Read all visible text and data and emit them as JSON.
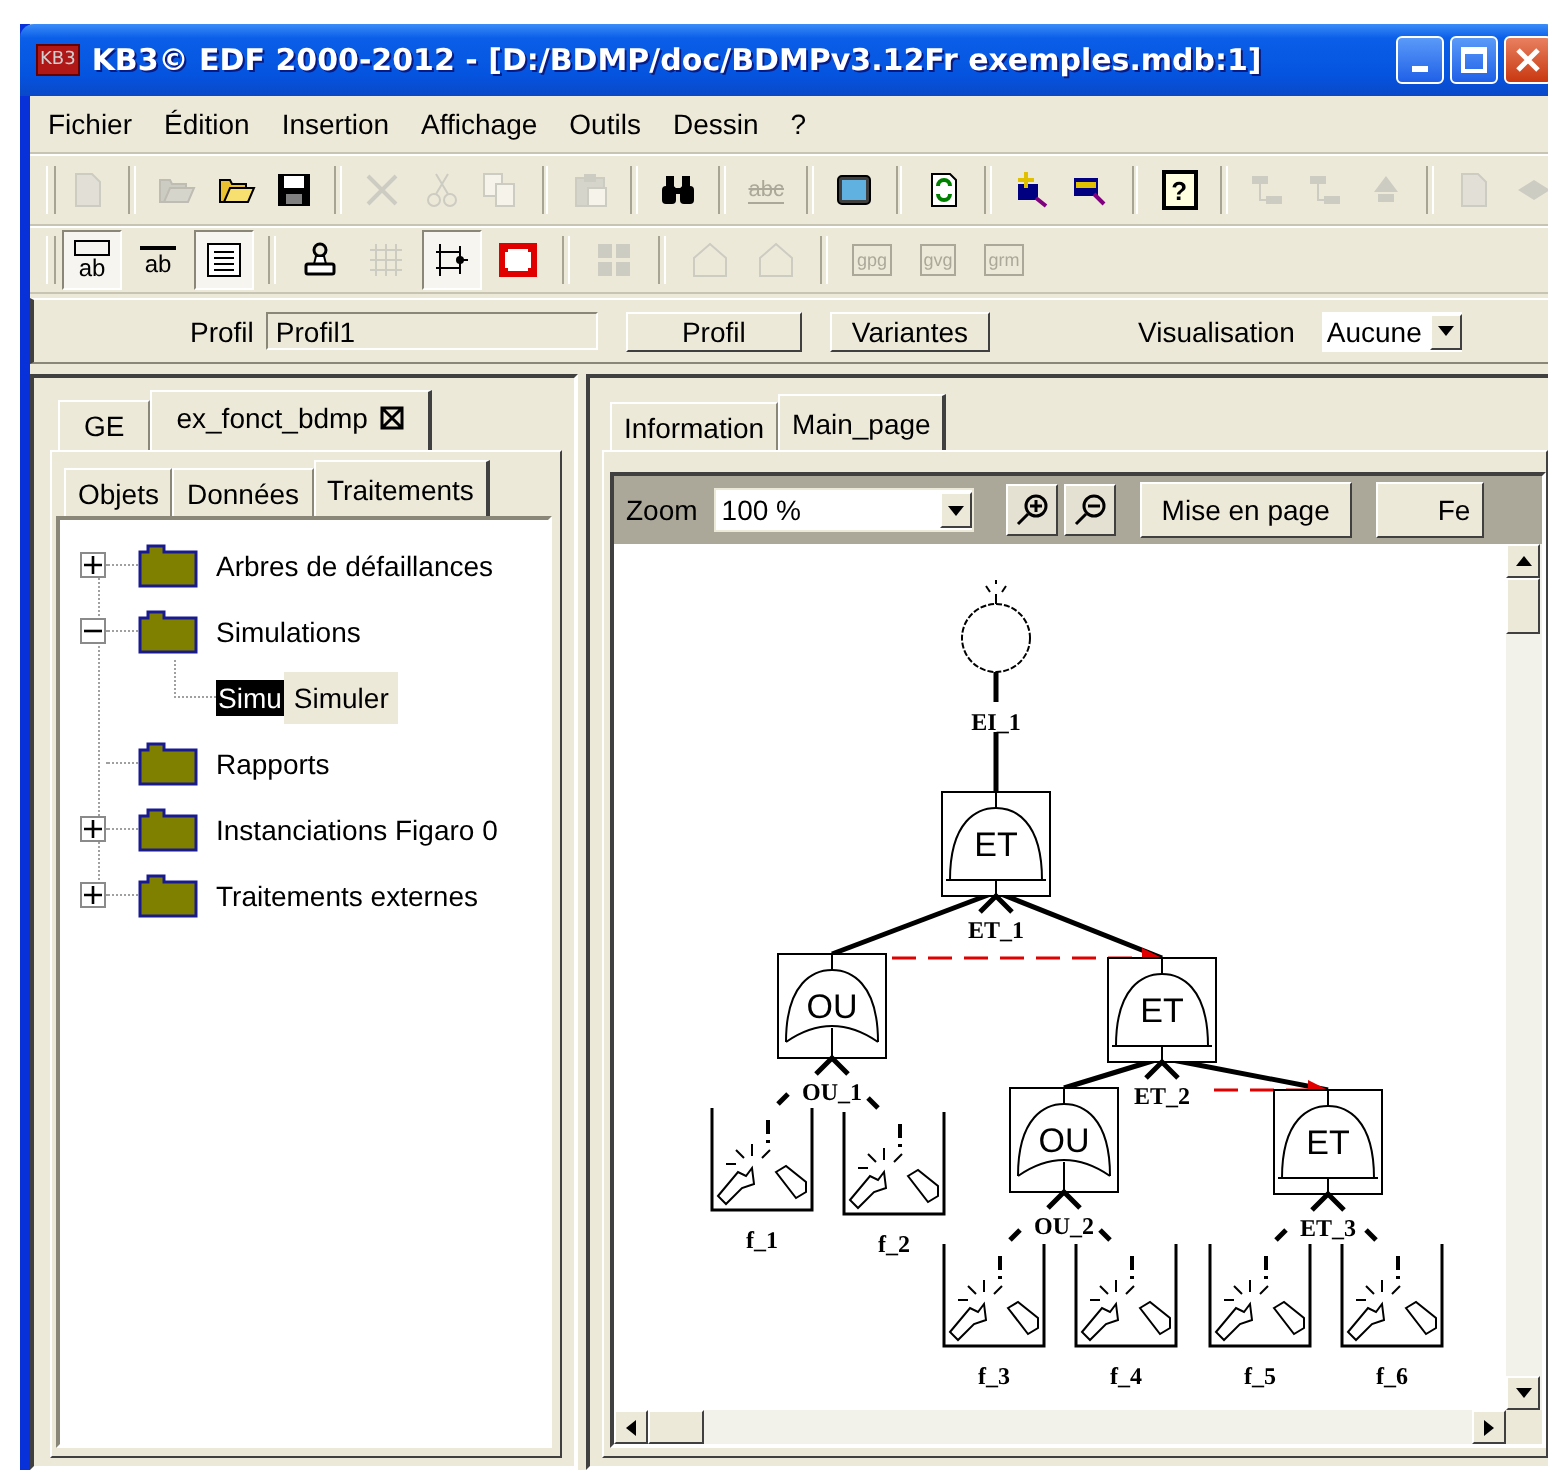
{
  "window": {
    "app_icon": "KB3",
    "title": "KB3© EDF 2000-2012 - [D:/BDMP/doc/BDMPv3.12Fr exemples.mdb:1]"
  },
  "menu": [
    "Fichier",
    "Édition",
    "Insertion",
    "Affichage",
    "Outils",
    "Dessin",
    "?"
  ],
  "toolbar_1": [
    {
      "kind": "new",
      "disabled": true
    },
    {
      "kind": "sep"
    },
    {
      "kind": "open",
      "disabled": true
    },
    {
      "kind": "open",
      "disabled": false
    },
    {
      "kind": "save",
      "disabled": false
    },
    {
      "kind": "sep"
    },
    {
      "kind": "delete",
      "disabled": true
    },
    {
      "kind": "cut",
      "disabled": true
    },
    {
      "kind": "copy",
      "disabled": true
    },
    {
      "kind": "sep"
    },
    {
      "kind": "paste",
      "disabled": true
    },
    {
      "kind": "sep"
    },
    {
      "kind": "find",
      "disabled": false
    },
    {
      "kind": "sep"
    },
    {
      "kind": "spell",
      "disabled": true,
      "text": "abc"
    },
    {
      "kind": "sep"
    },
    {
      "kind": "screen",
      "disabled": false
    },
    {
      "kind": "sep"
    },
    {
      "kind": "refresh",
      "disabled": false
    },
    {
      "kind": "sep"
    },
    {
      "kind": "add",
      "disabled": false
    },
    {
      "kind": "export",
      "disabled": false
    },
    {
      "kind": "sep"
    },
    {
      "kind": "help",
      "disabled": false,
      "text": "?"
    },
    {
      "kind": "sep"
    },
    {
      "kind": "tree",
      "disabled": true
    },
    {
      "kind": "tree",
      "disabled": true
    },
    {
      "kind": "triangle",
      "disabled": true
    },
    {
      "kind": "sep"
    },
    {
      "kind": "page",
      "disabled": true
    },
    {
      "kind": "diamond",
      "disabled": true
    }
  ],
  "toolbar_2": [
    {
      "kind": "label_box",
      "disabled": false,
      "pressed": true,
      "text": "ab"
    },
    {
      "kind": "label_line",
      "disabled": false,
      "pressed": false,
      "text": "ab"
    },
    {
      "kind": "text_doc",
      "disabled": false,
      "pressed": true
    },
    {
      "kind": "sep"
    },
    {
      "kind": "stamp",
      "disabled": false,
      "pressed": false
    },
    {
      "kind": "grid",
      "disabled": true,
      "pressed": false
    },
    {
      "kind": "branch",
      "disabled": false,
      "pressed": true
    },
    {
      "kind": "frame",
      "disabled": false,
      "pressed": false
    },
    {
      "kind": "sep"
    },
    {
      "kind": "tiles",
      "disabled": true,
      "pressed": false
    },
    {
      "kind": "sep"
    },
    {
      "kind": "house",
      "disabled": true,
      "pressed": false
    },
    {
      "kind": "house",
      "disabled": true,
      "pressed": false
    },
    {
      "kind": "sep"
    },
    {
      "kind": "tag",
      "disabled": true,
      "pressed": false,
      "text": "gpg"
    },
    {
      "kind": "tag",
      "disabled": true,
      "pressed": false,
      "text": "gvg"
    },
    {
      "kind": "tag",
      "disabled": true,
      "pressed": false,
      "text": "grm"
    }
  ],
  "profile_bar": {
    "profile_label": "Profil",
    "profile_value": "Profil1",
    "buttons": [
      "Profil",
      "Variantes"
    ],
    "view_label": "Visualisation",
    "view_value": "Aucune"
  },
  "left_panel": {
    "tabs": [
      {
        "label": "GE",
        "selected": false,
        "closable": false
      },
      {
        "label": "ex_fonct_bdmp",
        "selected": true,
        "closable": true
      }
    ],
    "subtabs": [
      {
        "label": "Objets",
        "selected": false
      },
      {
        "label": "Données",
        "selected": false
      },
      {
        "label": "Traitements",
        "selected": true
      }
    ],
    "tree": [
      {
        "label": "Arbres de défaillances",
        "expanded": false,
        "selected": false
      },
      {
        "label": "Simulations",
        "expanded": true,
        "selected": false,
        "children": [
          {
            "label": "Simu",
            "tooltip": "Simuler",
            "selected": true
          }
        ]
      },
      {
        "label": "Rapports",
        "selected": false
      },
      {
        "label": "Instanciations Figaro 0",
        "expanded": false,
        "selected": false
      },
      {
        "label": "Traitements externes",
        "expanded": false,
        "selected": false
      }
    ]
  },
  "right_panel": {
    "tabs": [
      {
        "label": "Information",
        "selected": false
      },
      {
        "label": "Main_page",
        "selected": true
      }
    ],
    "zoom_label": "Zoom",
    "zoom_value": "100 %",
    "buttons": [
      "Mise en page",
      "Fe"
    ],
    "diagram": {
      "kind": "top",
      "label": "EI_1",
      "children": [
        {
          "kind": "gate",
          "gate": "ET",
          "label": "ET_1",
          "children": [
            {
              "kind": "gate",
              "gate": "OU",
              "label": "OU_1",
              "children": [
                {
                  "kind": "basic",
                  "label": "f_1"
                },
                {
                  "kind": "basic",
                  "label": "f_2"
                }
              ]
            },
            {
              "kind": "gate",
              "gate": "ET",
              "label": "ET_2",
              "children": [
                {
                  "kind": "gate",
                  "gate": "OU",
                  "label": "OU_2",
                  "children": [
                    {
                      "kind": "basic",
                      "label": "f_3"
                    },
                    {
                      "kind": "basic",
                      "label": "f_4"
                    }
                  ]
                },
                {
                  "kind": "gate",
                  "gate": "ET",
                  "label": "ET_3",
                  "children": [
                    {
                      "kind": "basic",
                      "label": "f_5"
                    },
                    {
                      "kind": "basic",
                      "label": "f_6"
                    }
                  ]
                }
              ]
            }
          ]
        }
      ]
    }
  }
}
